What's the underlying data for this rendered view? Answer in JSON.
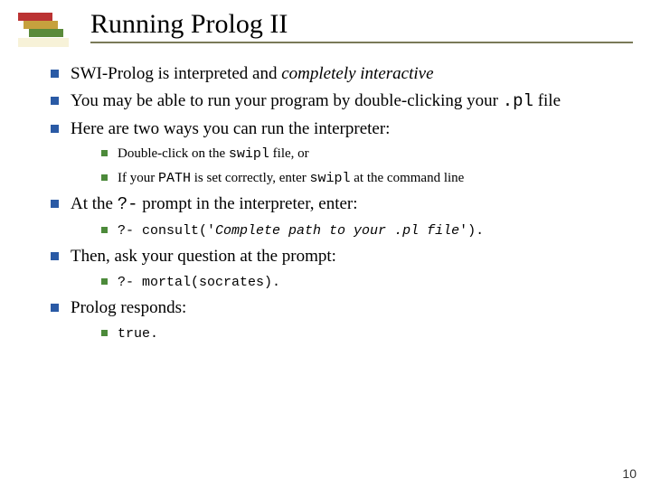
{
  "title": "Running Prolog II",
  "bullets": {
    "b1_pre": "SWI-Prolog is interpreted and ",
    "b1_em": "completely interactive",
    "b2_pre": "You may be able to run your program by double-clicking your ",
    "b2_code": ".pl",
    "b2_post": " file",
    "b3": "Here are two ways you can run the interpreter:",
    "b3a_pre": "Double-click on the ",
    "b3a_code": "swipl",
    "b3a_post": " file, or",
    "b3b_pre": "If your ",
    "b3b_code1": "PATH",
    "b3b_mid": " is set correctly, enter ",
    "b3b_code2": "swipl",
    "b3b_post": " at the command line",
    "b4_pre": "At the  ",
    "b4_code": "?-",
    "b4_post": "  prompt in the interpreter, enter:",
    "b4a_code_pre": "?- consult('",
    "b4a_ital": "Complete path to your .pl file",
    "b4a_code_post": "').",
    "b5": "Then, ask your question at the prompt:",
    "b5a_code": "?- mortal(socrates).",
    "b6": "Prolog responds:",
    "b6a_code": "true."
  },
  "page_number": "10"
}
